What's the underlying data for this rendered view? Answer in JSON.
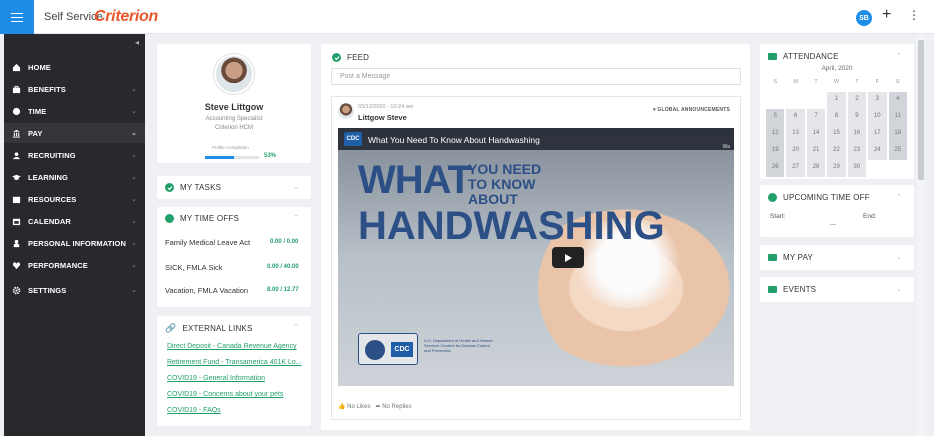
{
  "topbar": {
    "app_name": "Self Service",
    "brand": "Criterion",
    "user_badge": "SB",
    "add_symbol": "+",
    "more_symbol": "⋮"
  },
  "sidebar": {
    "items": [
      {
        "label": "HOME",
        "icon": "home-icon"
      },
      {
        "label": "BENEFITS",
        "icon": "briefcase-icon"
      },
      {
        "label": "TIME",
        "icon": "clock-icon"
      },
      {
        "label": "PAY",
        "icon": "bank-icon"
      },
      {
        "label": "RECRUITING",
        "icon": "users-icon"
      },
      {
        "label": "LEARNING",
        "icon": "graduation-icon"
      },
      {
        "label": "RESOURCES",
        "icon": "box-icon"
      },
      {
        "label": "CALENDAR",
        "icon": "calendar-icon"
      },
      {
        "label": "PERSONAL INFORMATION",
        "icon": "person-icon"
      },
      {
        "label": "PERFORMANCE",
        "icon": "heart-icon"
      },
      {
        "label": "SETTINGS",
        "icon": "gear-icon"
      }
    ]
  },
  "profile": {
    "name": "Steve Littgow",
    "title": "Accounting Specialist",
    "company": "Criterion HCM",
    "completion_label": "Profile Completion",
    "completion_pct": "53%",
    "completion_fraction": 0.53
  },
  "my_tasks": {
    "title": "MY TASKS"
  },
  "my_time_offs": {
    "title": "MY TIME OFFS",
    "rows": [
      {
        "label": "Family Medical Leave Act",
        "value": "0.00 / 0.00"
      },
      {
        "label": "SICK, FMLA Sick",
        "value": "0.00 / 40.00"
      },
      {
        "label": "Vacation, FMLA Vacation",
        "value": "8.00 / 12.77"
      }
    ]
  },
  "external_links": {
    "title": "EXTERNAL LINKS",
    "links": [
      "Direct Deposit - Canada Revenue Agency",
      "Retirement Fund - Transamerica 401K Lo...",
      "COVID19 - General Information",
      "COVID19 - Concerns about your pets",
      "COVID19 - FAQs"
    ]
  },
  "feed": {
    "title": "FEED",
    "post_placeholder": "Post a Message",
    "post": {
      "date": "03/12/2020 - 10:24 am",
      "author": "Littgow Steve",
      "tag": "GLOBAL ANNOUNCEMENTS",
      "video_title": "What You Need To Know About Handwashing",
      "video_channel": "CDC",
      "video_side": "Wa",
      "headline_1": "WHAT",
      "headline_2": "YOU NEED TO KNOW ABOUT",
      "headline_3": "HANDWASHING",
      "footer_logo": "CDC",
      "footer_org": "U.S. Department of Health and Human Services Centers for Disease Control and Prevention",
      "likes": "No Likes",
      "replies": "No Replies"
    }
  },
  "attendance": {
    "title": "ATTENDANCE",
    "month": "April, 2020",
    "day_headers": [
      "S",
      "M",
      "T",
      "W",
      "T",
      "F",
      "S"
    ],
    "weeks": [
      [
        "",
        "",
        "",
        "1",
        "2",
        "3",
        "4"
      ],
      [
        "5",
        "6",
        "7",
        "8",
        "9",
        "10",
        "11"
      ],
      [
        "12",
        "13",
        "14",
        "15",
        "16",
        "17",
        "18"
      ],
      [
        "19",
        "20",
        "21",
        "22",
        "23",
        "24",
        "25"
      ],
      [
        "26",
        "27",
        "28",
        "29",
        "30",
        "",
        ""
      ]
    ]
  },
  "upcoming_time_off": {
    "title": "UPCOMING TIME OFF",
    "start_label": "Start:",
    "end_label": "End:",
    "value": "—"
  },
  "my_pay": {
    "title": "MY PAY"
  },
  "events": {
    "title": "EVENTS"
  },
  "colors": {
    "accent": "#1f8ce6",
    "brand": "#e8572a",
    "green": "#22a06b",
    "sidebar": "#27292d"
  }
}
